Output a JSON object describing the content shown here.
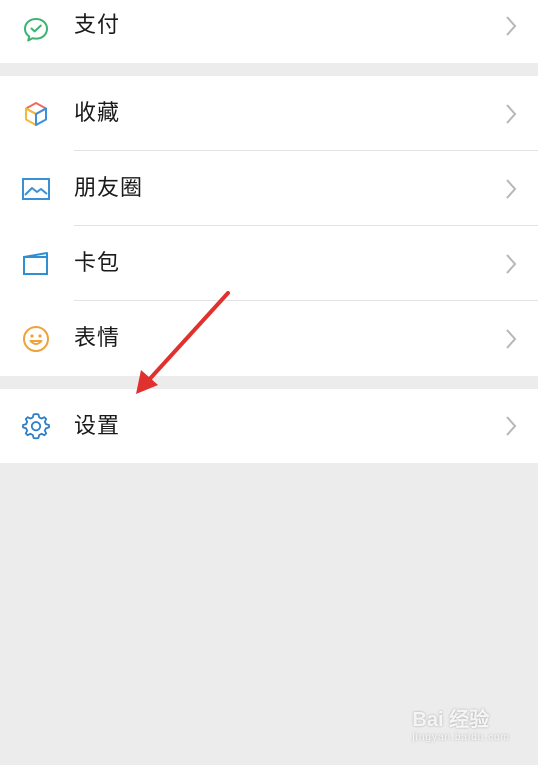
{
  "menu": {
    "pay": {
      "label": "支付",
      "icon": "wechat-pay-icon"
    },
    "favorites": {
      "label": "收藏",
      "icon": "cube-icon"
    },
    "moments": {
      "label": "朋友圈",
      "icon": "picture-icon"
    },
    "card_wallet": {
      "label": "卡包",
      "icon": "card-icon"
    },
    "stickers": {
      "label": "表情",
      "icon": "smiley-icon"
    },
    "settings": {
      "label": "设置",
      "icon": "gear-icon"
    }
  },
  "colors": {
    "background": "#ececec",
    "row_background": "#ffffff",
    "pay_green": "#3cb371",
    "moments_blue": "#3b8fd6",
    "card_blue": "#2f8fd2",
    "smiley_orange": "#f0a23a",
    "gear_blue": "#2e7fc7",
    "annotation_red": "#e0312e"
  },
  "watermark": {
    "brand": "Bai 经验",
    "url": "jingyan.baidu.com"
  }
}
